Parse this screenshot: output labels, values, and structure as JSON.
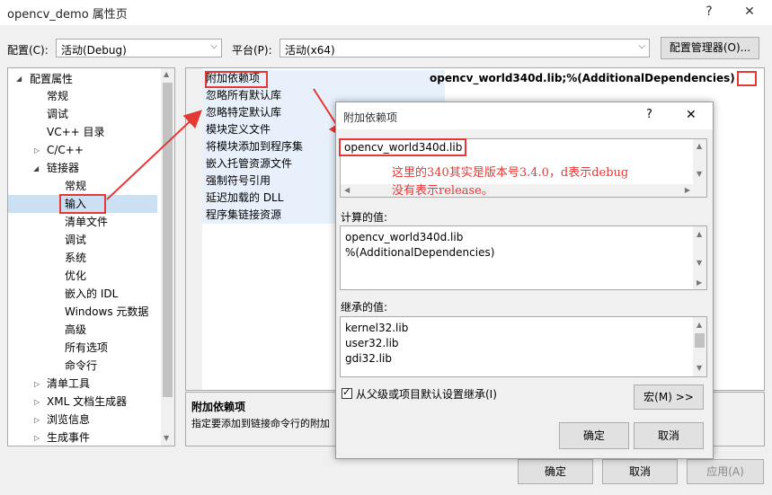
{
  "window": {
    "title": "opencv_demo 属性页",
    "help": "?",
    "close": "✕"
  },
  "toolbar": {
    "config_label": "配置(C):",
    "config_value": "活动(Debug)",
    "platform_label": "平台(P):",
    "platform_value": "活动(x64)",
    "config_manager": "配置管理器(O)..."
  },
  "tree": {
    "root": "配置属性",
    "items": [
      "常规",
      "调试",
      "VC++ 目录",
      "C/C++",
      "链接器",
      "常规",
      "输入",
      "清单文件",
      "调试",
      "系统",
      "优化",
      "嵌入的 IDL",
      "Windows 元数据",
      "高级",
      "所有选项",
      "命令行",
      "清单工具",
      "XML 文档生成器",
      "浏览信息",
      "生成事件"
    ]
  },
  "properties": {
    "rows": [
      "附加依赖项",
      "忽略所有默认库",
      "忽略特定默认库",
      "模块定义文件",
      "将模块添加到程序集",
      "嵌入托管资源文件",
      "强制符号引用",
      "延迟加载的 DLL",
      "程序集链接资源"
    ],
    "value": "opencv_world340d.lib;%(AdditionalDependencies)",
    "desc_title": "附加依赖项",
    "desc_text": "指定要添加到链接命令行的附加"
  },
  "footer": {
    "ok": "确定",
    "cancel": "取消",
    "apply": "应用(A)"
  },
  "dialog": {
    "title": "附加依赖项",
    "help": "?",
    "close": "✕",
    "edit_value": "opencv_world340d.lib",
    "annotation_line1": "这里的340其实是版本号3.4.0，d表示debug",
    "annotation_line2": "没有表示release。",
    "computed_label": "计算的值:",
    "computed_values": [
      "opencv_world340d.lib",
      "%(AdditionalDependencies)"
    ],
    "inherited_label": "继承的值:",
    "inherited_values": [
      "kernel32.lib",
      "user32.lib",
      "gdi32.lib"
    ],
    "inherit_checkbox": "从父级或项目默认设置继承(I)",
    "macro_button": "宏(M) >>",
    "ok": "确定",
    "cancel": "取消"
  },
  "colors": {
    "annotation_red": "#e53935",
    "selection": "#cce0f3"
  }
}
